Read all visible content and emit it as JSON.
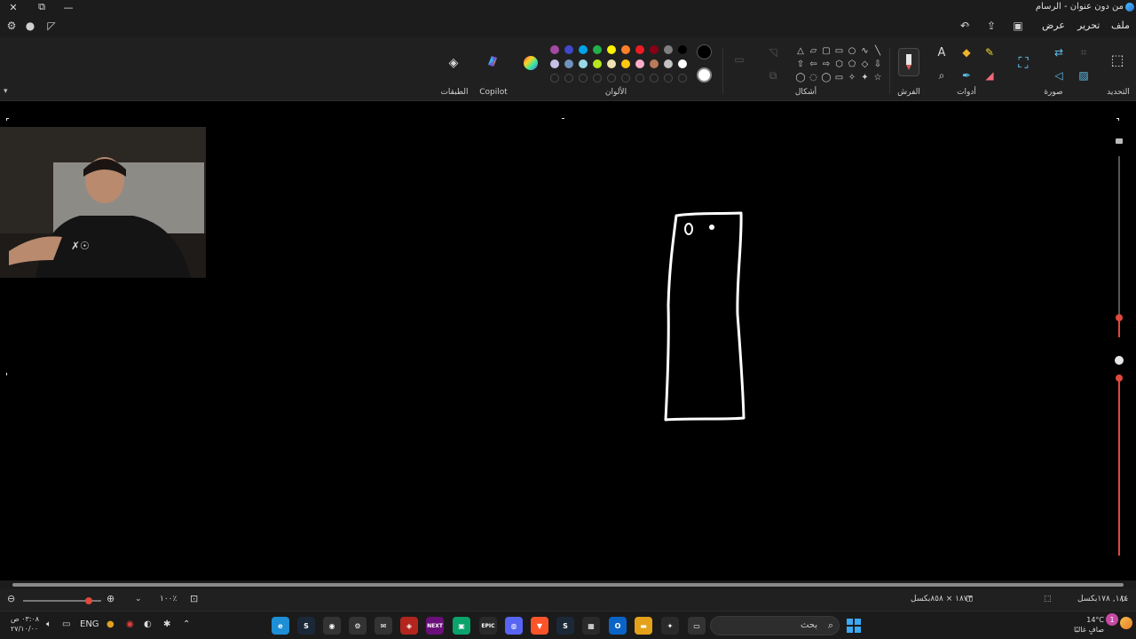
{
  "window": {
    "title": "من دون عنوان - الرسام",
    "controls": {
      "close": "✕",
      "restore": "⧉",
      "minimize": "—"
    }
  },
  "menu": {
    "file": "ملف",
    "edit": "تحرير",
    "view": "عرض"
  },
  "ribbon": {
    "groups": {
      "selection": "التحديد",
      "image": "صورة",
      "tools": "أدوات",
      "brushes": "الفرش",
      "shapes": "أشكال",
      "colors": "الألوان",
      "copilot": "Copilot",
      "layers": "الطبقات"
    },
    "palette_row1": [
      "#000000",
      "#7f7f7f",
      "#880015",
      "#ed1c24",
      "#ff7f27",
      "#fff200",
      "#22b14c",
      "#00a2e8",
      "#3f48cc",
      "#a349a4"
    ],
    "palette_row2": [
      "#ffffff",
      "#c3c3c3",
      "#b97a57",
      "#ffaec9",
      "#ffc90e",
      "#efe4b0",
      "#b5e61d",
      "#99d9ea",
      "#7092be",
      "#c8bfe7"
    ],
    "primary_color": "#000000",
    "secondary_color": "#ffffff"
  },
  "status": {
    "cursor_position": "١٨٤, ١٧٨بكسل",
    "canvas_size": "١٨٧٣ × ٨٥٨بكسل",
    "zoom": "١٠٠٪"
  },
  "taskbar": {
    "search_placeholder": "بحث",
    "language": "ENG",
    "clock_time": "٠٣:٠٨ ص",
    "clock_date": "٢٧/١٠/٠٠",
    "weather_temp": "14°C",
    "weather_desc": "صافٍ غالبًا",
    "notification_count": "1",
    "apps": [
      {
        "name": "edge",
        "glyph": "e",
        "color": "#1e8fd6"
      },
      {
        "name": "steam",
        "glyph": "S",
        "color": "#1b2838"
      },
      {
        "name": "obs",
        "glyph": "◉",
        "color": "#333"
      },
      {
        "name": "settings",
        "glyph": "⚙",
        "color": "#333"
      },
      {
        "name": "mail",
        "glyph": "✉",
        "color": "#333"
      },
      {
        "name": "brave-red",
        "glyph": "◈",
        "color": "#b3261e"
      },
      {
        "name": "next",
        "glyph": "NEXT",
        "color": "#6b0f7a"
      },
      {
        "name": "green-app",
        "glyph": "▣",
        "color": "#0aa36b"
      },
      {
        "name": "epic",
        "glyph": "EPIC",
        "color": "#2a2a2a"
      },
      {
        "name": "discord",
        "glyph": "◍",
        "color": "#5865f2"
      },
      {
        "name": "brave",
        "glyph": "▼",
        "color": "#fb542b"
      },
      {
        "name": "steam2",
        "glyph": "S",
        "color": "#1b2838"
      },
      {
        "name": "store",
        "glyph": "▦",
        "color": "#2a2a2a"
      },
      {
        "name": "outlook",
        "glyph": "O",
        "color": "#0a64c8"
      },
      {
        "name": "explorer",
        "glyph": "▬",
        "color": "#e3a21a"
      },
      {
        "name": "copilot",
        "glyph": "✦",
        "color": "#2a2a2a"
      },
      {
        "name": "paint",
        "glyph": "▭",
        "color": "#333"
      }
    ]
  }
}
